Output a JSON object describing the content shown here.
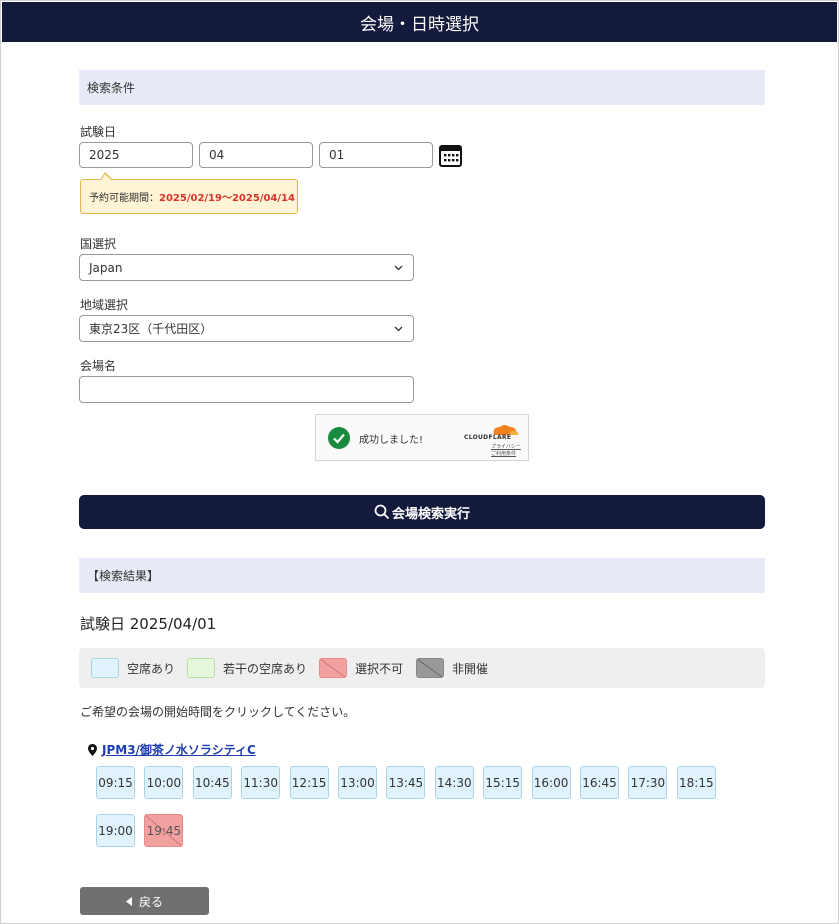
{
  "header": {
    "title": "会場・日時選択"
  },
  "search": {
    "section_title": "検索条件",
    "date_label": "試験日",
    "year": "2025",
    "month": "04",
    "day": "01",
    "availability_prefix": "予約可能期間：",
    "availability_range": "2025/02/19〜2025/04/14",
    "country_label": "国選択",
    "country_value": "Japan",
    "region_label": "地域選択",
    "region_value": "東京23区（千代田区）",
    "venue_name_label": "会場名",
    "venue_name_value": "",
    "captcha_status": "成功しました!",
    "captcha_brand": "CLOUDFLARE",
    "captcha_privacy": "プライバシー",
    "captcha_terms": "ご利用条件",
    "submit_label": "会場検索実行"
  },
  "results": {
    "section_title": "【検索結果】",
    "date_heading": "試験日 2025/04/01",
    "legend": [
      {
        "label": "空席あり",
        "color": "#e0f3fc"
      },
      {
        "label": "若干の空席あり",
        "color": "#e6f7dc"
      },
      {
        "label": "選択不可",
        "color": "#f2a1a1"
      },
      {
        "label": "非開催",
        "color": "#999999"
      }
    ],
    "instruction": "ご希望の会場の開始時間をクリックしてください。",
    "venue": {
      "name": "JPM3/御茶ノ水ソラシティC",
      "slots": [
        {
          "time": "09:15",
          "status": "空席あり"
        },
        {
          "time": "10:00",
          "status": "空席あり"
        },
        {
          "time": "10:45",
          "status": "空席あり"
        },
        {
          "time": "11:30",
          "status": "空席あり"
        },
        {
          "time": "12:15",
          "status": "空席あり"
        },
        {
          "time": "13:00",
          "status": "空席あり"
        },
        {
          "time": "13:45",
          "status": "空席あり"
        },
        {
          "time": "14:30",
          "status": "空席あり"
        },
        {
          "time": "15:15",
          "status": "空席あり"
        },
        {
          "time": "16:00",
          "status": "空席あり"
        },
        {
          "time": "16:45",
          "status": "空席あり"
        },
        {
          "time": "17:30",
          "status": "空席あり"
        },
        {
          "time": "18:15",
          "status": "空席あり"
        },
        {
          "time": "19:00",
          "status": "空席あり"
        },
        {
          "time": "19:45",
          "status": "選択不可"
        }
      ]
    }
  },
  "footer": {
    "back_label": "戻る"
  }
}
